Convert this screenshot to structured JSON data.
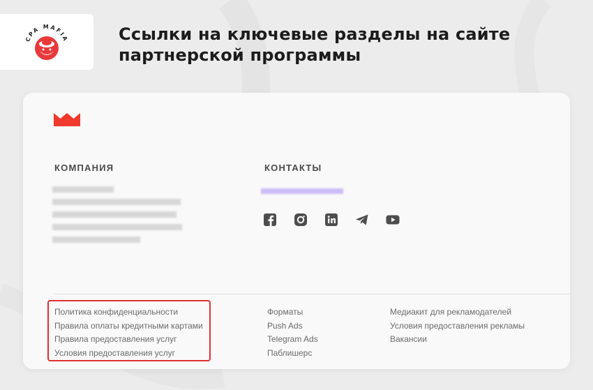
{
  "logo": {
    "text": "CPA MAFIA",
    "accent": "#e8393b"
  },
  "headline": "Ссылки на ключевые разделы на сайте партнерской программы",
  "footer": {
    "brand_color": "#f03a2d",
    "company_title": "КОМПАНИЯ",
    "contacts_title": "КОНТАКТЫ",
    "socials": [
      {
        "icon": "facebook-icon"
      },
      {
        "icon": "instagram-icon"
      },
      {
        "icon": "linkedin-icon"
      },
      {
        "icon": "telegram-icon"
      },
      {
        "icon": "youtube-icon"
      }
    ],
    "col1": [
      "Политика конфиденциальности",
      "Правила оплаты кредитными картами",
      "Правила предоставления услуг",
      "Условия предоставления услуг"
    ],
    "col2": [
      "Форматы",
      "Push Ads",
      "Telegram Ads",
      "Паблишерс"
    ],
    "col3": [
      "Медиакит для рекламодателей",
      "Условия предоставления рекламы",
      "Вакансии"
    ],
    "highlight_color": "#e03131"
  }
}
